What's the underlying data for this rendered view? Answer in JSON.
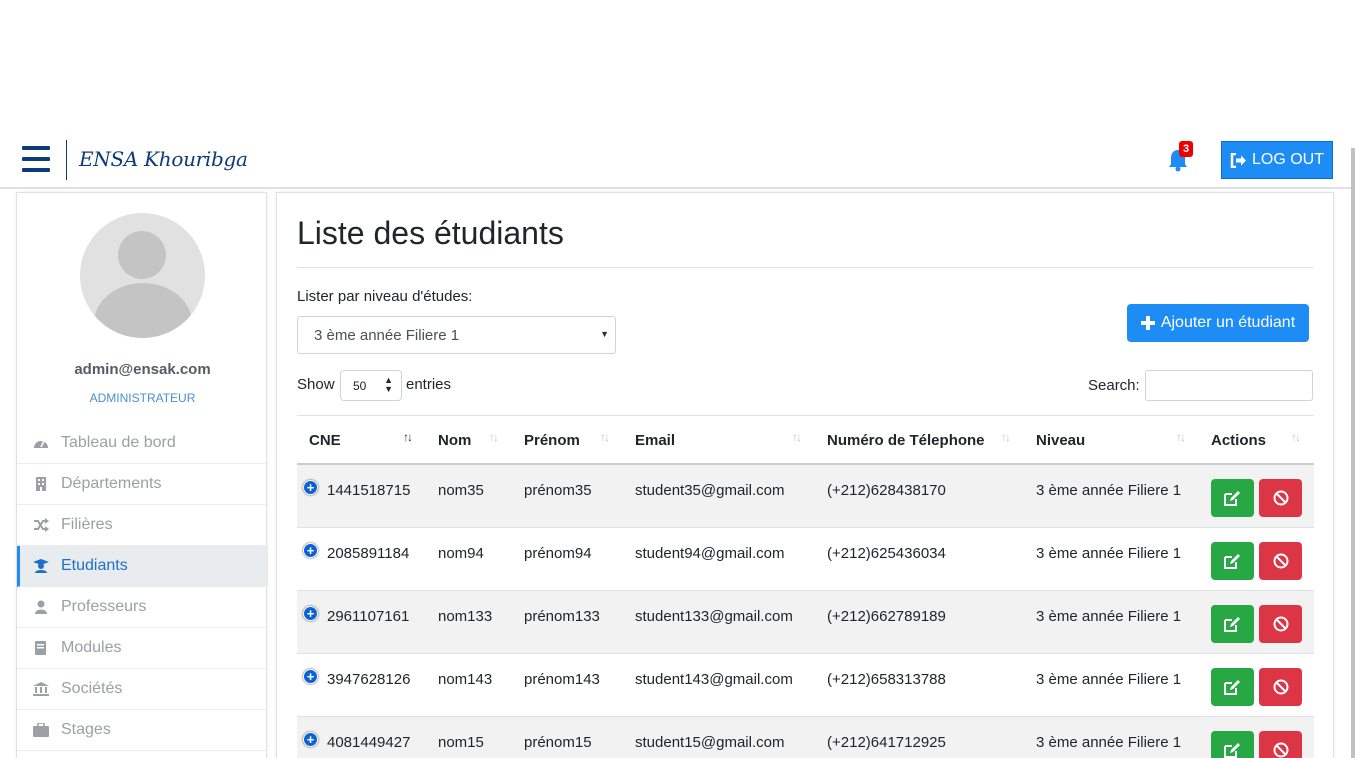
{
  "navbar": {
    "brand": "ENSA Khouribga",
    "notification_count": "3",
    "logout_label": "LOG OUT"
  },
  "sidebar": {
    "email": "admin@ensak.com",
    "role": "ADMINISTRATEUR",
    "items": [
      {
        "label": "Tableau de bord",
        "icon": "dashboard-icon"
      },
      {
        "label": "Départements",
        "icon": "building-icon"
      },
      {
        "label": "Filières",
        "icon": "shuffle-icon"
      },
      {
        "label": "Etudiants",
        "icon": "student-icon"
      },
      {
        "label": "Professeurs",
        "icon": "user-icon"
      },
      {
        "label": "Modules",
        "icon": "book-icon"
      },
      {
        "label": "Sociétés",
        "icon": "bank-icon"
      },
      {
        "label": "Stages",
        "icon": "briefcase-icon"
      }
    ],
    "active_item": "Etudiants"
  },
  "main": {
    "title": "Liste des étudiants",
    "filter_label": "Lister par niveau d'études:",
    "filter_value": "3 ème année Filiere 1",
    "add_button": "Ajouter un étudiant",
    "show_label": "Show",
    "entries_value": "50",
    "entries_label": "entries",
    "search_label": "Search:",
    "search_value": ""
  },
  "table": {
    "columns": [
      "CNE",
      "Nom",
      "Prénom",
      "Email",
      "Numéro de Télephone",
      "Niveau",
      "Actions"
    ],
    "sorted_column": "CNE",
    "rows": [
      [
        "1441518715",
        "nom35",
        "prénom35",
        "student35@gmail.com",
        "(+212)628438170",
        "3 ème année Filiere 1"
      ],
      [
        "2085891184",
        "nom94",
        "prénom94",
        "student94@gmail.com",
        "(+212)625436034",
        "3 ème année Filiere 1"
      ],
      [
        "2961107161",
        "nom133",
        "prénom133",
        "student133@gmail.com",
        "(+212)662789189",
        "3 ème année Filiere 1"
      ],
      [
        "3947628126",
        "nom143",
        "prénom143",
        "student143@gmail.com",
        "(+212)658313788",
        "3 ème année Filiere 1"
      ],
      [
        "4081449427",
        "nom15",
        "prénom15",
        "student15@gmail.com",
        "(+212)641712925",
        "3 ème année Filiere 1"
      ]
    ]
  },
  "colors": {
    "primary": "#1e8cf5",
    "brand": "#0c3c78",
    "success": "#28a745",
    "danger": "#dc3545",
    "badge": "#ee0000"
  }
}
